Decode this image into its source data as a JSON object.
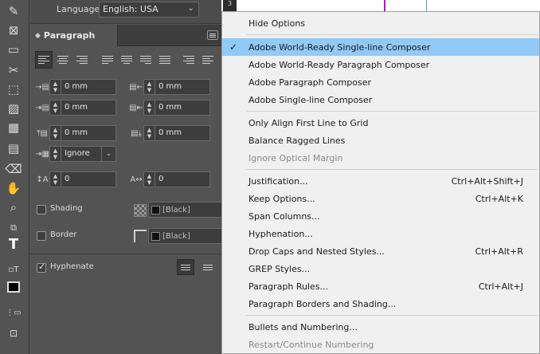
{
  "panel": {
    "language_label": "Language:",
    "language_value": "English: USA",
    "tab_title": "Paragraph",
    "left_indent": "0 mm",
    "right_indent": "0 mm",
    "first_line_indent": "0 mm",
    "last_line_indent": "0 mm",
    "space_before": "0 mm",
    "space_after": "0 mm",
    "align_to_grid": "Ignore",
    "drop_cap_lines": "0",
    "drop_cap_chars": "0",
    "shading_label": "Shading",
    "shading_swatch": "[Black]",
    "border_label": "Border",
    "border_swatch": "[Black]",
    "hyphenate_label": "Hyphenate"
  },
  "ruler_text": "3",
  "menu": {
    "items": [
      {
        "label": "Hide Options",
        "shortcut": ""
      },
      {
        "label": "Adobe World-Ready Single-line Composer",
        "shortcut": "",
        "checked": true,
        "highlighted": true
      },
      {
        "label": "Adobe World-Ready Paragraph Composer",
        "shortcut": ""
      },
      {
        "label": "Adobe Paragraph Composer",
        "shortcut": ""
      },
      {
        "label": "Adobe Single-line Composer",
        "shortcut": ""
      },
      {
        "label": "Only Align First Line to Grid",
        "shortcut": ""
      },
      {
        "label": "Balance Ragged Lines",
        "shortcut": ""
      },
      {
        "label": "Ignore Optical Margin",
        "shortcut": "",
        "disabled": true
      },
      {
        "label": "Justification...",
        "shortcut": "Ctrl+Alt+Shift+J"
      },
      {
        "label": "Keep Options...",
        "shortcut": "Ctrl+Alt+K"
      },
      {
        "label": "Span Columns...",
        "shortcut": ""
      },
      {
        "label": "Hyphenation...",
        "shortcut": ""
      },
      {
        "label": "Drop Caps and Nested Styles...",
        "shortcut": "Ctrl+Alt+R"
      },
      {
        "label": "GREP Styles...",
        "shortcut": ""
      },
      {
        "label": "Paragraph Rules...",
        "shortcut": "Ctrl+Alt+J"
      },
      {
        "label": "Paragraph Borders and Shading...",
        "shortcut": ""
      },
      {
        "label": "Bullets and Numbering...",
        "shortcut": ""
      },
      {
        "label": "Restart/Continue Numbering",
        "shortcut": "",
        "disabled": true
      }
    ]
  },
  "colors": {
    "menu_highlight": "#91c9f7",
    "panel_bg": "#535353",
    "menu_bg": "#f0f0f0"
  }
}
